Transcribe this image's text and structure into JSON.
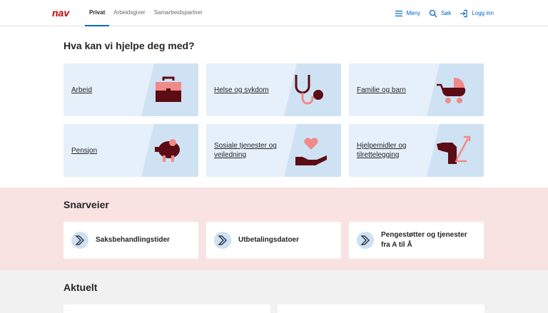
{
  "header": {
    "logo_text": "nav",
    "tabs": [
      {
        "label": "Privat",
        "active": true
      },
      {
        "label": "Arbeidsgiver",
        "active": false
      },
      {
        "label": "Samarbeidspartner",
        "active": false
      }
    ],
    "menu_label": "Meny",
    "search_label": "Søk",
    "login_label": "Logg inn"
  },
  "help": {
    "title": "Hva kan vi hjelpe deg med?",
    "cards": [
      {
        "label": "Arbeid",
        "icon": "briefcase-icon"
      },
      {
        "label": "Helse og sykdom",
        "icon": "stethoscope-icon"
      },
      {
        "label": "Familie og barn",
        "icon": "stroller-icon"
      },
      {
        "label": "Pensjon",
        "icon": "piggy-bank-icon"
      },
      {
        "label": "Sosiale tjenester og veiledning",
        "icon": "heart-hand-icon"
      },
      {
        "label": "Hjelpemidler og tilrettelegging",
        "icon": "guide-dog-icon"
      }
    ]
  },
  "shortcuts": {
    "title": "Snarveier",
    "items": [
      {
        "label": "Saksbehandlingstider"
      },
      {
        "label": "Utbetalingsdatoer"
      },
      {
        "label": "Pengestøtter og tjenester fra A til Å"
      }
    ]
  },
  "news": {
    "title": "Aktuelt"
  },
  "colors": {
    "brand_red": "#c30000",
    "link_blue": "#0067c5",
    "card_blue": "#e6f0fa",
    "shortcut_bg": "#f9e3e2",
    "news_bg": "#f1f1f1",
    "illustration_dark": "#5c0c14",
    "illustration_pink": "#f08a8a"
  }
}
